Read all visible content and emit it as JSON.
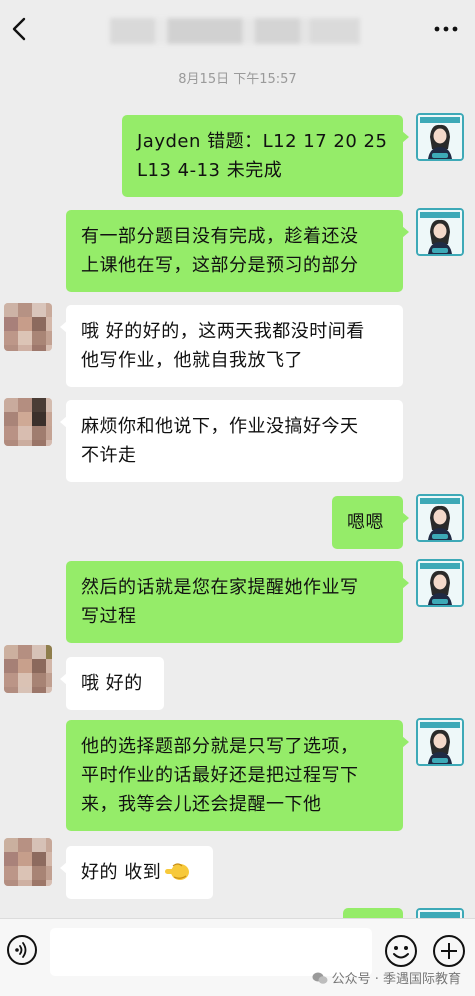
{
  "header": {
    "timestamp": "8月15日 下午15:57"
  },
  "messages": [
    {
      "side": "right",
      "text": "Jayden 错题：L12 17 20 25\nL13 4-13 未完成"
    },
    {
      "side": "right",
      "text": "有一部分题目没有完成，趁着还没\n上课他在写，这部分是预习的部分"
    },
    {
      "side": "left",
      "text": "哦 好的好的，这两天我都没时间看\n他写作业，他就自我放飞了"
    },
    {
      "side": "left",
      "text": "麻烦你和他说下，作业没搞好今天\n不许走"
    },
    {
      "side": "right",
      "text": "嗯嗯"
    },
    {
      "side": "right",
      "text": "然后的话就是您在家提醒她作业写\n写过程"
    },
    {
      "side": "left",
      "text": "哦 好的"
    },
    {
      "side": "right",
      "text": "他的选择题部分就是只写了选项，\n平时作业的话最好还是把过程写下\n来，我等会儿还会提醒一下他"
    },
    {
      "side": "left",
      "text": "好的 收到"
    }
  ],
  "footer": {
    "watermark": "公众号 · 季遇国际教育"
  },
  "colors": {
    "background": "#ededed",
    "bubble_sent": "#95ec69",
    "bubble_received": "#ffffff",
    "avatar_border": "#3da9b7"
  },
  "icons": {
    "back": "chevron-left-icon",
    "more": "more-dots-icon",
    "voice": "voice-icon",
    "emoji": "smile-icon",
    "plus": "plus-icon",
    "reaction": "pointing-hand-emoji"
  }
}
